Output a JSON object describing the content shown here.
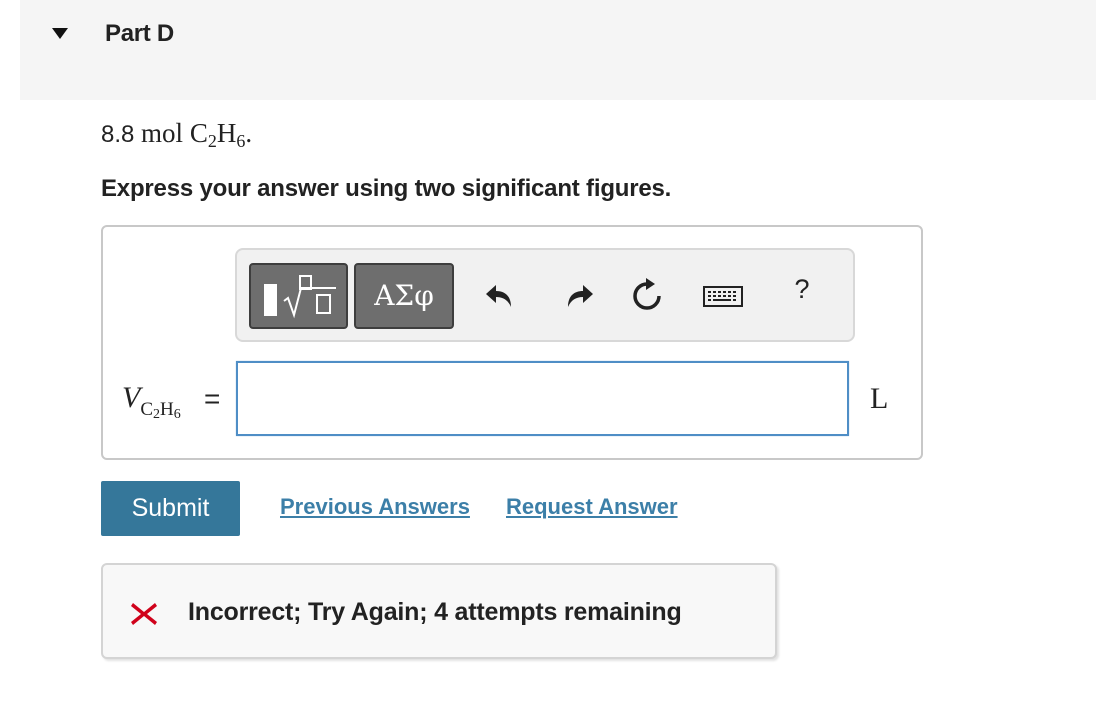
{
  "header": {
    "title": "Part D"
  },
  "problem": {
    "amount": "8.8",
    "unit": "mol",
    "formula": {
      "c": "C",
      "c_sub": "2",
      "h": "H",
      "h_sub": "6"
    },
    "period": "."
  },
  "instruction": "Express your answer using two significant figures.",
  "toolbar": {
    "template_button_icon": "sqrt-template-icon",
    "greek_label": "ΑΣφ",
    "undo_icon": "undo-icon",
    "redo_icon": "redo-icon",
    "reset_icon": "reset-icon",
    "keyboard_icon": "keyboard-icon",
    "help_label": "?"
  },
  "answer": {
    "variable": "V",
    "variable_sub_c": "C",
    "variable_sub_c_n": "2",
    "variable_sub_h": "H",
    "variable_sub_h_n": "6",
    "equals": "=",
    "value": "",
    "unit": "L"
  },
  "actions": {
    "submit_label": "Submit",
    "previous_answers_label": "Previous Answers",
    "request_answer_label": "Request Answer"
  },
  "feedback": {
    "icon": "x-icon",
    "message": "Incorrect; Try Again; 4 attempts remaining",
    "icon_color": "#d0021b"
  },
  "colors": {
    "submit_bg": "#35779a",
    "link": "#3c7fa8",
    "input_border": "#4f8ec6",
    "header_bg": "#f5f5f5"
  }
}
